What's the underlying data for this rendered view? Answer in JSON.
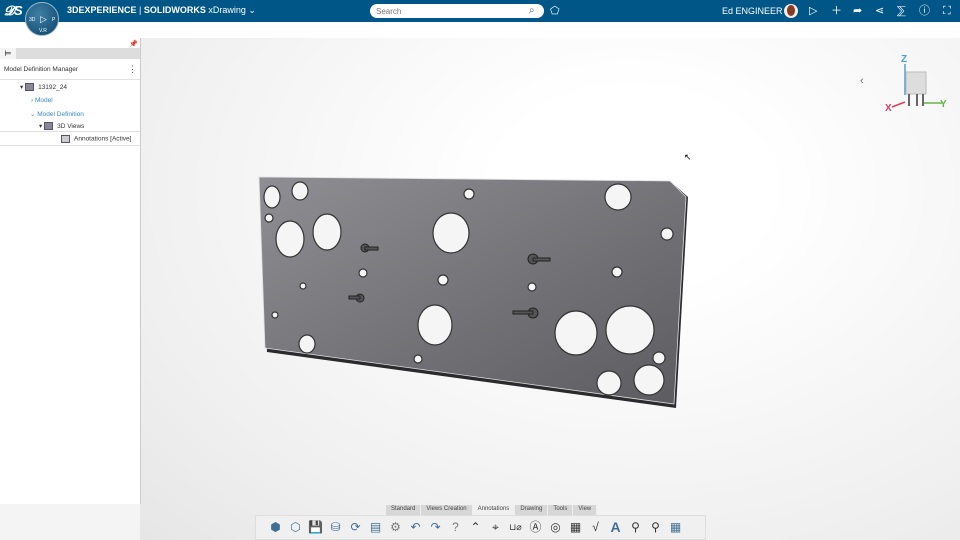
{
  "topbar": {
    "brand_logo": "3DS",
    "compass_labels": [
      "V.R",
      "3D",
      "I",
      "P"
    ],
    "product": "3DEXPERIENCE",
    "separator": " | ",
    "app": "SOLIDWORKS",
    "role": "xDrawing",
    "search_placeholder": "Search",
    "user_name": "Ed ENGINEER",
    "icons": [
      "tag-icon",
      "notifications-icon",
      "add-icon",
      "share-arrow-icon",
      "share-icon",
      "community-icon",
      "help-icon",
      "fullscreen-icon"
    ]
  },
  "panel": {
    "title": "Model Definition Manager",
    "tree": [
      {
        "label": "13192_24"
      },
      {
        "label": "Model"
      },
      {
        "label": "Model Definition"
      },
      {
        "label": "3D Views"
      },
      {
        "label": "Annotations [Active]"
      }
    ]
  },
  "triad": {
    "z": "Z",
    "x": "X",
    "y": "Y"
  },
  "command_tabs": [
    "Standard",
    "Views Creation",
    "Annotations",
    "Drawing",
    "Tools",
    "View"
  ],
  "active_command_tab": "Annotations",
  "toolbar_icons": [
    "3d-view-icon",
    "view-icon",
    "save-icon",
    "database-icon",
    "rebuild-icon",
    "sheet-icon",
    "settings-icon",
    "undo-icon",
    "redo-icon",
    "help-icon",
    "smart-dimension-icon",
    "center-mark-icon",
    "location-dimension-icon",
    "datum-icon",
    "datum-target-icon",
    "gtol-icon",
    "surface-finish-icon",
    "note-icon",
    "balloon-icon",
    "auto-balloon-icon",
    "table-icon"
  ],
  "colors": {
    "topbar": "#005686",
    "link": "#3a8ac2"
  }
}
